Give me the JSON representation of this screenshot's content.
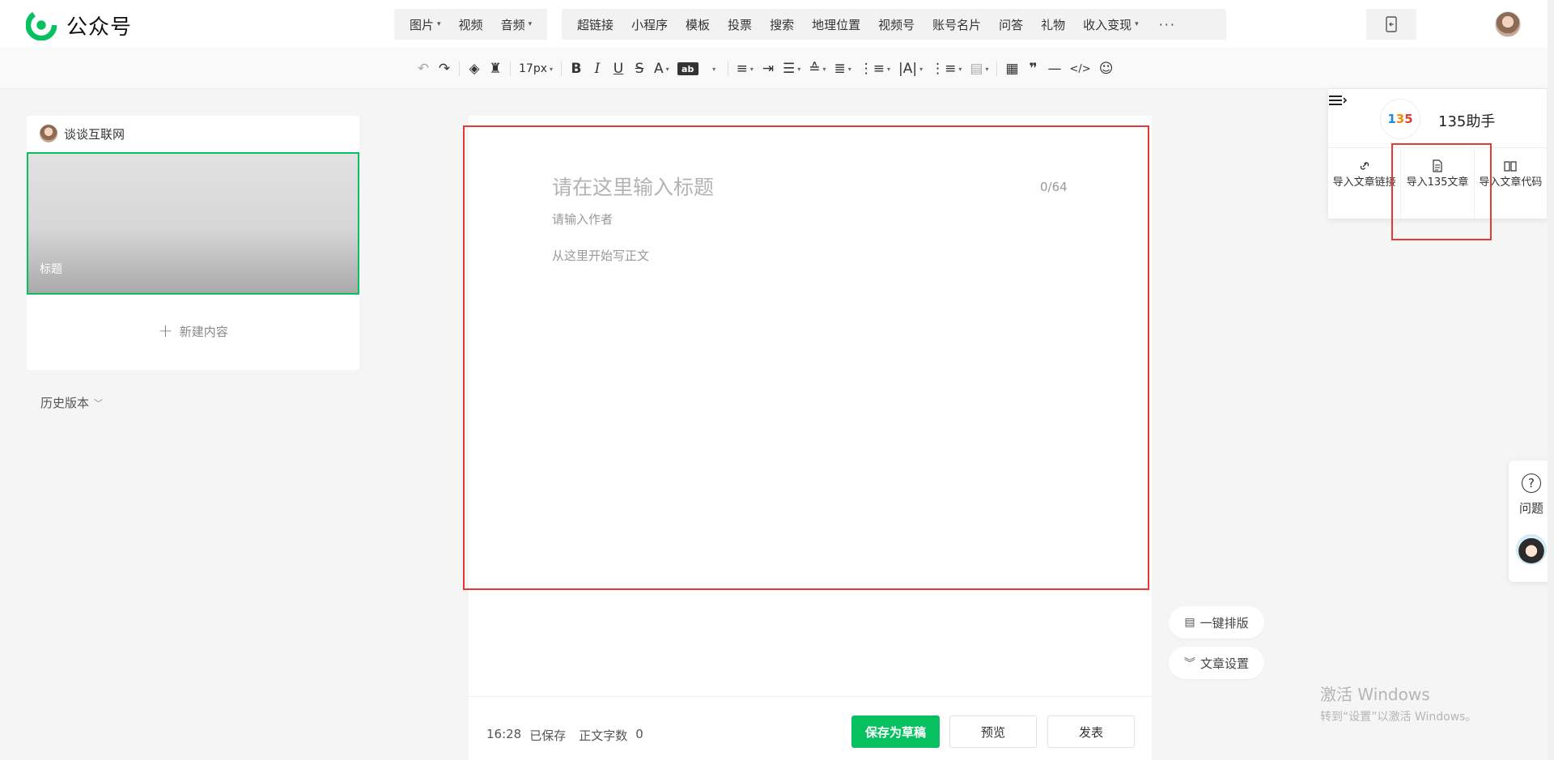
{
  "topbar": {
    "logo_text": "公众号",
    "insert_group1": [
      {
        "label": "图片",
        "dropdown": true
      },
      {
        "label": "视频",
        "dropdown": false
      },
      {
        "label": "音频",
        "dropdown": true
      }
    ],
    "insert_group2": [
      {
        "label": "超链接",
        "dropdown": false
      },
      {
        "label": "小程序",
        "dropdown": false
      },
      {
        "label": "模板",
        "dropdown": false
      },
      {
        "label": "投票",
        "dropdown": false
      },
      {
        "label": "搜索",
        "dropdown": false
      },
      {
        "label": "地理位置",
        "dropdown": false
      },
      {
        "label": "视频号",
        "dropdown": false
      },
      {
        "label": "账号名片",
        "dropdown": false
      },
      {
        "label": "问答",
        "dropdown": false
      },
      {
        "label": "礼物",
        "dropdown": false
      },
      {
        "label": "收入变现",
        "dropdown": true
      }
    ],
    "more_label": "···",
    "accent_color": "#07c160"
  },
  "editor_toolbar": {
    "font_size": "17px",
    "ab_label": "ab"
  },
  "left_panel": {
    "account_name": "谈谈互联网",
    "cover_title": "标题",
    "new_content_label": "新建内容",
    "history_label": "历史版本"
  },
  "editor": {
    "title_placeholder": "请在这里输入标题",
    "title_count": "0/64",
    "author_placeholder": "请输入作者",
    "body_placeholder": "从这里开始写正文"
  },
  "bottom_bar": {
    "time": "16:28",
    "saved_label": "已保存",
    "word_count_label": "正文字数",
    "word_count": "0",
    "save_draft_label": "保存为草稿",
    "preview_label": "预览",
    "publish_label": "发表"
  },
  "side_actions": {
    "one_click_layout": "一键排版",
    "article_settings": "文章设置"
  },
  "helper_panel": {
    "logo_chars": [
      "1",
      "3",
      "5"
    ],
    "name": "135助手",
    "actions": [
      {
        "label": "导入文章链接",
        "icon": "link-icon"
      },
      {
        "label": "导入135文章",
        "icon": "document-icon"
      },
      {
        "label": "导入文章代码",
        "icon": "book-icon"
      }
    ]
  },
  "float_help": {
    "label": "问题"
  },
  "watermark": {
    "line1": "激活 Windows",
    "line2": "转到“设置”以激活 Windows。"
  }
}
